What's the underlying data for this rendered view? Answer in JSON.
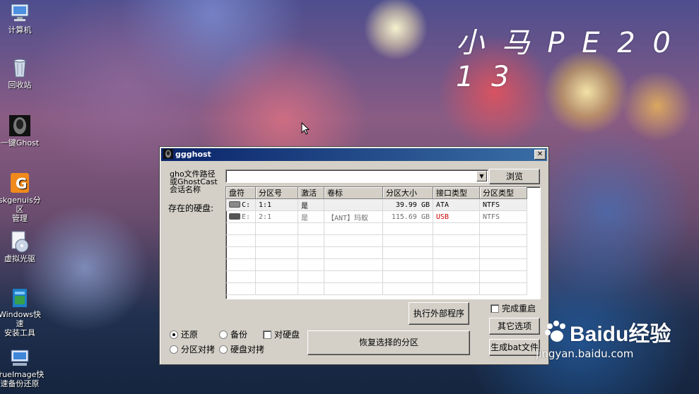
{
  "desktop": {
    "icons": [
      {
        "label_lines": [
          "计算机"
        ]
      },
      {
        "label_lines": [
          "回收站"
        ]
      },
      {
        "label_lines": [
          "一键Ghost"
        ]
      },
      {
        "label_lines": [
          "skgenuis分区",
          "管理"
        ]
      },
      {
        "label_lines": [
          "虚拟光驱"
        ]
      },
      {
        "label_lines": [
          "Windows快速",
          "安装工具"
        ]
      },
      {
        "label_lines": [
          "TrueImage快",
          "速备份还原"
        ]
      }
    ],
    "logo": "小 马 P E 2 0 1 3",
    "watermark": {
      "brand": "Baidu经验",
      "url": "jingyan.baidu.com"
    }
  },
  "window": {
    "title": "ggghost",
    "close_glyph": "✕",
    "path_label_lines": [
      "gho文件路径",
      "或GhostCast",
      "会话名称"
    ],
    "path_value": "",
    "browse_label": "浏览",
    "disks_label": "存在的硬盘:",
    "table": {
      "columns": [
        "盘符",
        "分区号",
        "激活",
        "卷标",
        "分区大小",
        "接口类型",
        "分区类型"
      ],
      "rows": [
        {
          "drive": "C:",
          "partition": "1:1",
          "active": "是",
          "volume": "",
          "size": "39.99 GB",
          "interface": "ATA",
          "fstype": "NTFS"
        },
        {
          "drive": "E:",
          "partition": "2:1",
          "active": "是",
          "volume": "【ANT】玛蚁",
          "size": "115.69 GB",
          "interface": "USB",
          "fstype": "NTFS"
        }
      ]
    },
    "run_external_label": "执行外部程序",
    "restart_label": "完成重启",
    "other_options_label": "其它选项",
    "generate_bat_label": "生成bat文件",
    "restore_selected_label": "恢复选择的分区",
    "mode": {
      "restore": "还原",
      "backup": "备份",
      "to_disk": "对硬盘",
      "partition_copy": "分区对拷",
      "disk_copy": "硬盘对拷",
      "selected": "restore"
    },
    "usb_color": "#d00000"
  }
}
